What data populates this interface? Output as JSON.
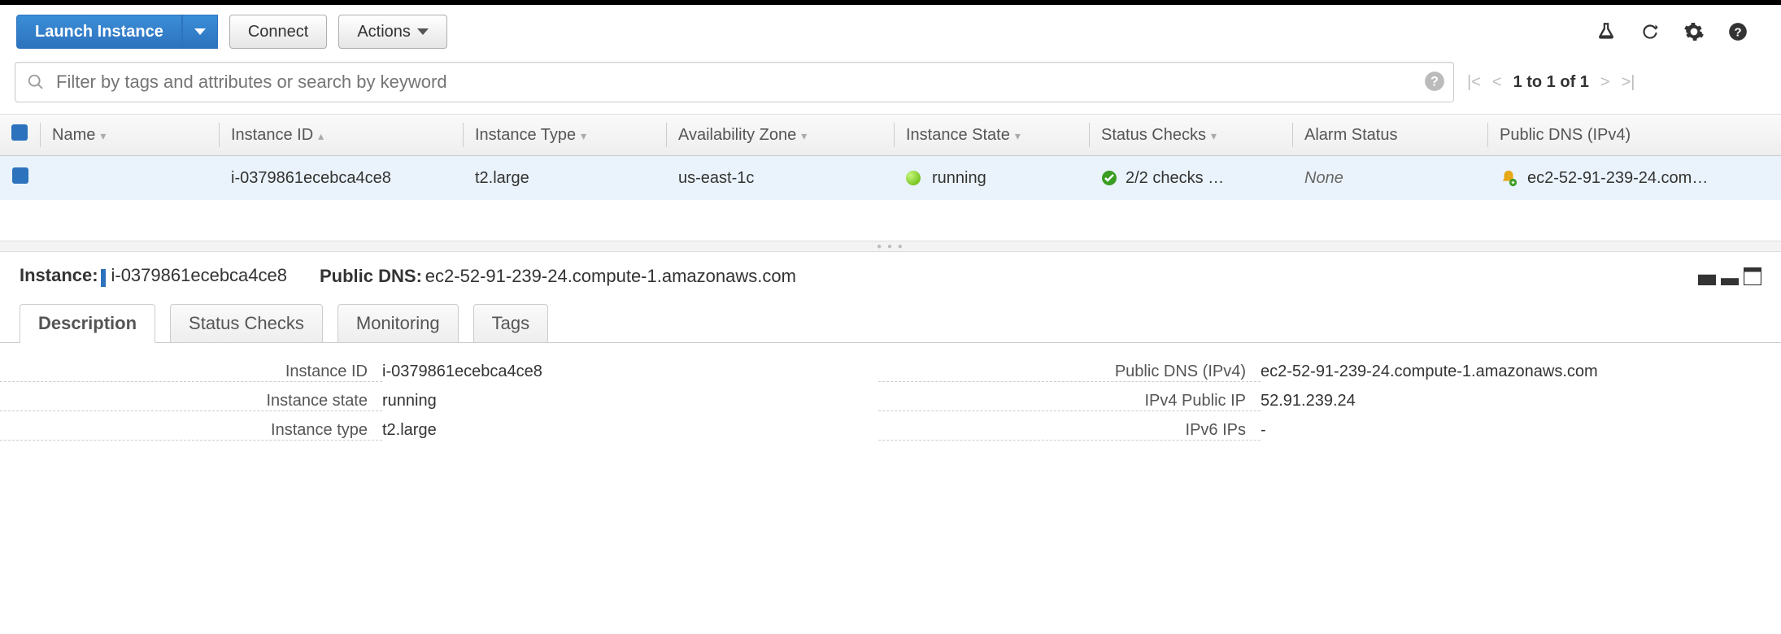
{
  "toolbar": {
    "launch_label": "Launch Instance",
    "connect_label": "Connect",
    "actions_label": "Actions"
  },
  "search": {
    "placeholder": "Filter by tags and attributes or search by keyword"
  },
  "pager": {
    "text": "1 to 1 of 1"
  },
  "table": {
    "headers": {
      "name": "Name",
      "instance_id": "Instance ID",
      "instance_type": "Instance Type",
      "az": "Availability Zone",
      "state": "Instance State",
      "status": "Status Checks",
      "alarm": "Alarm Status",
      "dns": "Public DNS (IPv4)"
    },
    "rows": [
      {
        "name": "",
        "instance_id": "i-0379861ecebca4ce8",
        "instance_type": "t2.large",
        "az": "us-east-1c",
        "state": "running",
        "status": "2/2 checks …",
        "alarm": "None",
        "dns": "ec2-52-91-239-24.com…"
      }
    ]
  },
  "detail": {
    "instance_label": "Instance:",
    "instance_id": "i-0379861ecebca4ce8",
    "public_dns_label": "Public DNS:",
    "public_dns": "ec2-52-91-239-24.compute-1.amazonaws.com",
    "tabs": {
      "description": "Description",
      "status_checks": "Status Checks",
      "monitoring": "Monitoring",
      "tags": "Tags"
    },
    "fields": {
      "instance_id_label": "Instance ID",
      "instance_id": "i-0379861ecebca4ce8",
      "instance_state_label": "Instance state",
      "instance_state": "running",
      "instance_type_label": "Instance type",
      "instance_type": "t2.large",
      "public_dns_label": "Public DNS (IPv4)",
      "public_dns": "ec2-52-91-239-24.compute-1.amazonaws.com",
      "ipv4_label": "IPv4 Public IP",
      "ipv4": "52.91.239.24",
      "ipv6_label": "IPv6 IPs",
      "ipv6": "-"
    }
  }
}
